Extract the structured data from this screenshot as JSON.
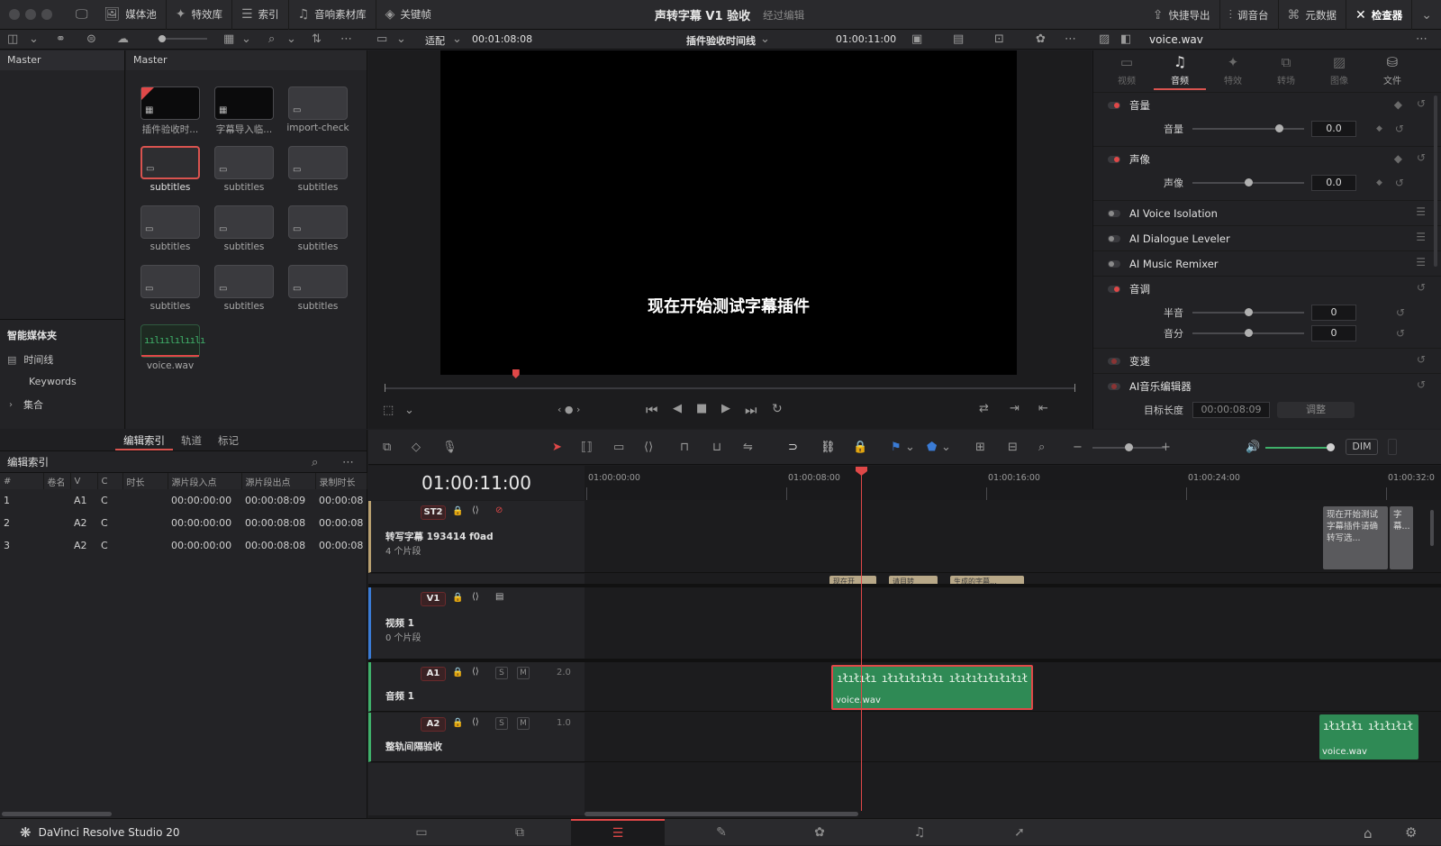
{
  "topbar": {
    "media_pool": "媒体池",
    "effects": "特效库",
    "index": "索引",
    "sound_library": "音响素材库",
    "keyframes": "关键帧",
    "project_title": "声转字幕 V1 验收",
    "edit_status": "经过编辑",
    "quick_export": "快捷导出",
    "mixer": "调音台",
    "metadata": "元数据",
    "inspector": "检查器"
  },
  "viewer": {
    "fit": "适配",
    "source_tc": "00:01:08:08",
    "timeline_name": "插件验收时间线",
    "record_tc": "01:00:11:00",
    "subtitle_text": "现在开始测试字幕插件",
    "scrub_position": 0.19
  },
  "bins": {
    "master_left": "Master",
    "master_right": "Master",
    "smart_bins_title": "智能媒体夹",
    "smart_items": [
      "时间线",
      "Keywords",
      "集合"
    ]
  },
  "media": [
    {
      "label": "插件验收时..."
    },
    {
      "label": "字幕导入临..."
    },
    {
      "label": "import-check"
    },
    {
      "label": "subtitles"
    },
    {
      "label": "subtitles"
    },
    {
      "label": "subtitles"
    },
    {
      "label": "subtitles"
    },
    {
      "label": "subtitles"
    },
    {
      "label": "subtitles"
    },
    {
      "label": "subtitles"
    },
    {
      "label": "subtitles"
    },
    {
      "label": "subtitles"
    },
    {
      "label": "voice.wav"
    }
  ],
  "inspector": {
    "clip_name": "voice.wav",
    "tabs": [
      "视频",
      "音频",
      "特效",
      "转场",
      "图像",
      "文件"
    ],
    "volume_section": "音量",
    "volume_label": "音量",
    "volume_value": "0.0",
    "pan_section": "声像",
    "pan_label": "声像",
    "pan_value": "0.0",
    "ai_voice": "AI Voice Isolation",
    "ai_dialogue": "AI Dialogue Leveler",
    "ai_music": "AI Music Remixer",
    "pitch_section": "音调",
    "semitone_label": "半音",
    "semitone_value": "0",
    "cents_label": "音分",
    "cents_value": "0",
    "speed_section": "变速",
    "music_editor": "AI音乐编辑器",
    "target_length_label": "目标长度",
    "target_length_value": "00:00:08:09",
    "adjust_button": "调整"
  },
  "edit_index": {
    "tabs": [
      "编辑索引",
      "轨道",
      "标记"
    ],
    "title": "编辑索引",
    "columns": [
      "#",
      "卷名",
      "V",
      "C",
      "时长",
      "源片段入点",
      "源片段出点",
      "录制时长"
    ],
    "rows": [
      [
        "1",
        "",
        "A1",
        "C",
        "",
        "00:00:00:00",
        "00:00:08:09",
        "00:00:08"
      ],
      [
        "2",
        "",
        "A2",
        "C",
        "",
        "00:00:00:00",
        "00:00:08:08",
        "00:00:08"
      ],
      [
        "3",
        "",
        "A2",
        "C",
        "",
        "00:00:00:00",
        "00:00:08:08",
        "00:00:08"
      ]
    ]
  },
  "timeline": {
    "timecode": "01:00:11:00",
    "ruler": [
      "01:00:00:00",
      "01:00:08:00",
      "01:00:16:00",
      "01:00:24:00",
      "01:00:32:0"
    ],
    "dim": "DIM",
    "tracks": {
      "st2": {
        "id": "ST2",
        "name": "转写字幕 193414 f0ad",
        "count": "4 个片段"
      },
      "v1": {
        "id": "V1",
        "name": "视频 1",
        "count": "0 个片段"
      },
      "a1": {
        "id": "A1",
        "name": "音频 1",
        "level": "2.0"
      },
      "a2": {
        "id": "A2",
        "name": "整轨间隔验收",
        "level": "1.0"
      }
    },
    "sub_clip_1": "现在开始测试字幕插件请确转写选...",
    "sub_clip_2": "字幕...",
    "st1_clips": [
      "现在开",
      "请目转",
      "生成的字幕..."
    ],
    "a1_clip": "voice.wav",
    "a2_clip": "voice.wav",
    "s_label": "S",
    "m_label": "M"
  },
  "footer": {
    "app_name": "DaVinci Resolve Studio 20"
  }
}
